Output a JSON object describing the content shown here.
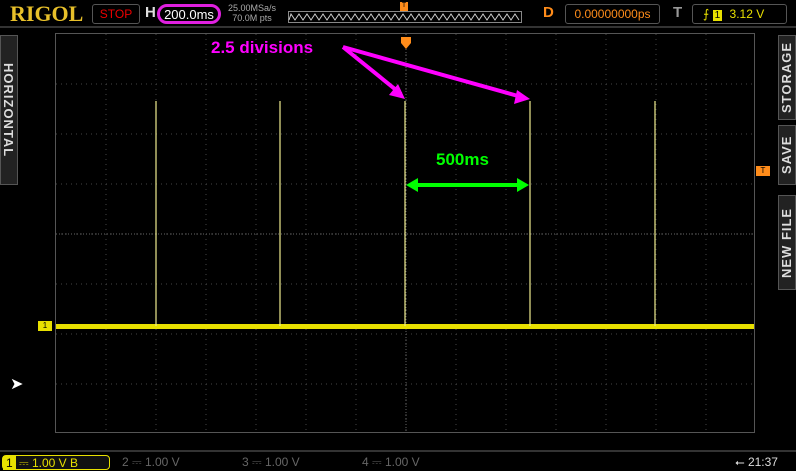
{
  "header": {
    "logo": "RIGOL",
    "run_state": "STOP",
    "h_label": "H",
    "timebase": "200.0ms",
    "sample_rate": "25.00MSa/s",
    "memory_depth": "70.0M pts",
    "d_label": "D",
    "delay": "0.00000000ps",
    "t_label": "T",
    "trigger_channel": "1",
    "trigger_level": "3.12 V"
  },
  "left_menu": {
    "label": "HORIZONTAL"
  },
  "right_menu": {
    "items": [
      "STORAGE",
      "SAVE",
      "NEW FILE"
    ]
  },
  "annotations": {
    "divisions": "2.5 divisions",
    "period": "500ms"
  },
  "channels": [
    {
      "num": "1",
      "scale": "1.00 V",
      "active": true
    },
    {
      "num": "2",
      "scale": "1.00 V",
      "active": false
    },
    {
      "num": "3",
      "scale": "1.00 V",
      "active": false
    },
    {
      "num": "4",
      "scale": "1.00 V",
      "active": false
    }
  ],
  "status": {
    "time": "21:37"
  },
  "colors": {
    "ch1": "#e8e000",
    "annotation_magenta": "#ff00ff",
    "annotation_green": "#00ff00",
    "orange": "#ff8c1a"
  }
}
